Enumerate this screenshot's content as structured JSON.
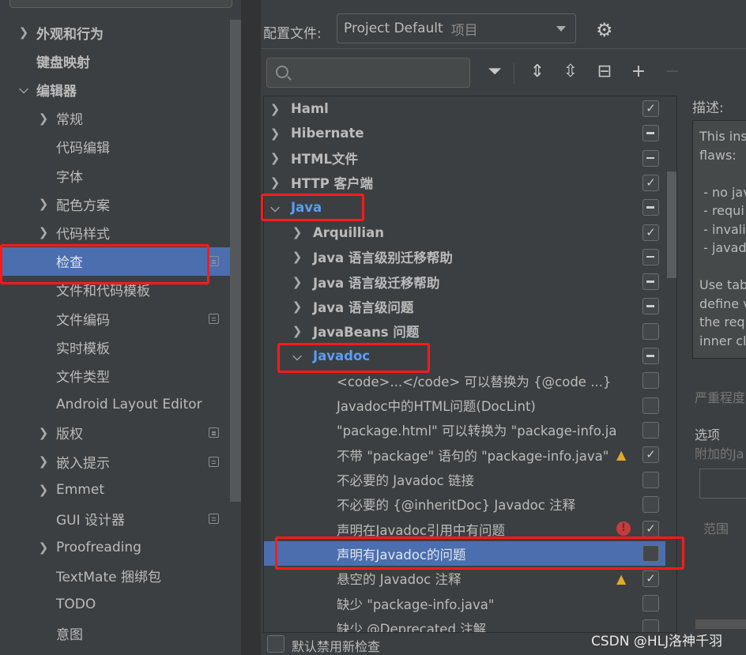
{
  "sidebar": {
    "items": [
      {
        "label": "外观和行为",
        "chevron": "right",
        "bold": true,
        "indent": 0
      },
      {
        "label": "键盘映射",
        "chevron": "",
        "bold": true,
        "indent": 0
      },
      {
        "label": "编辑器",
        "chevron": "down",
        "bold": true,
        "indent": 0
      },
      {
        "label": "常规",
        "chevron": "right",
        "indent": 1
      },
      {
        "label": "代码编辑",
        "chevron": "",
        "indent": 1
      },
      {
        "label": "字体",
        "chevron": "",
        "indent": 1
      },
      {
        "label": "配色方案",
        "chevron": "right",
        "indent": 1
      },
      {
        "label": "代码样式",
        "chevron": "right",
        "indent": 1
      },
      {
        "label": "检查",
        "chevron": "",
        "indent": 1,
        "selected": true,
        "copy": true
      },
      {
        "label": "文件和代码模板",
        "chevron": "",
        "indent": 1
      },
      {
        "label": "文件编码",
        "chevron": "",
        "indent": 1,
        "copy": true
      },
      {
        "label": "实时模板",
        "chevron": "",
        "indent": 1
      },
      {
        "label": "文件类型",
        "chevron": "",
        "indent": 1
      },
      {
        "label": "Android Layout Editor",
        "chevron": "",
        "indent": 1
      },
      {
        "label": "版权",
        "chevron": "right",
        "indent": 1,
        "copy": true
      },
      {
        "label": "嵌入提示",
        "chevron": "right",
        "indent": 1,
        "copy": true
      },
      {
        "label": "Emmet",
        "chevron": "right",
        "indent": 1
      },
      {
        "label": "GUI 设计器",
        "chevron": "",
        "indent": 1,
        "copy": true
      },
      {
        "label": "Proofreading",
        "chevron": "right",
        "indent": 1
      },
      {
        "label": "TextMate 捆绑包",
        "chevron": "",
        "indent": 1
      },
      {
        "label": "TODO",
        "chevron": "",
        "indent": 1
      },
      {
        "label": "意图",
        "chevron": "",
        "indent": 1
      }
    ]
  },
  "profile": {
    "label": "配置文件:",
    "value": "Project Default",
    "scope": "项目"
  },
  "toolbar": {
    "icons": [
      "filter-icon",
      "expand-all-icon",
      "collapse-all-icon",
      "reset-icon",
      "add-icon",
      "remove-icon"
    ]
  },
  "search": {
    "value": "",
    "placeholder": ""
  },
  "tree": {
    "rows": [
      {
        "label": "Haml",
        "level": 0,
        "chevron": "right",
        "state": "checked",
        "bold": true
      },
      {
        "label": "Hibernate",
        "level": 0,
        "chevron": "right",
        "state": "mixed",
        "bold": true
      },
      {
        "label": "HTML文件",
        "level": 0,
        "chevron": "right",
        "state": "mixed",
        "bold": true
      },
      {
        "label": "HTTP 客户端",
        "level": 0,
        "chevron": "right",
        "state": "checked",
        "bold": true
      },
      {
        "label": "Java",
        "level": 0,
        "chevron": "down",
        "state": "mixed",
        "bold": true,
        "highlight": true
      },
      {
        "label": "Arquillian",
        "level": 1,
        "chevron": "right",
        "state": "checked",
        "bold": true
      },
      {
        "label": "Java 语言级别迁移帮助",
        "level": 1,
        "chevron": "right",
        "state": "mixed",
        "bold": true
      },
      {
        "label": "Java 语言级迁移帮助",
        "level": 1,
        "chevron": "right",
        "state": "mixed",
        "bold": true
      },
      {
        "label": "Java 语言级问题",
        "level": 1,
        "chevron": "right",
        "state": "mixed",
        "bold": true
      },
      {
        "label": "JavaBeans 问题",
        "level": 1,
        "chevron": "right",
        "state": "unchecked",
        "bold": true
      },
      {
        "label": "Javadoc",
        "level": 1,
        "chevron": "down",
        "state": "mixed",
        "bold": true,
        "highlight": true
      },
      {
        "label": "<code>...</code> 可以替换为 {@code ...}",
        "level": 2,
        "state": "unchecked"
      },
      {
        "label": "Javadoc中的HTML问题(DocLint)",
        "level": 2,
        "state": "unchecked"
      },
      {
        "label": "\"package.html\" 可以转换为 \"package-info.ja",
        "level": 2,
        "state": "unchecked"
      },
      {
        "label": "不带 \"package\" 语句的 \"package-info.java\"",
        "level": 2,
        "state": "checked",
        "severity": "warning"
      },
      {
        "label": "不必要的 Javadoc 链接",
        "level": 2,
        "state": "unchecked"
      },
      {
        "label": "不必要的 {@inheritDoc} Javadoc 注释",
        "level": 2,
        "state": "unchecked"
      },
      {
        "label": "声明在Javadoc引用中有问题",
        "level": 2,
        "state": "checked",
        "severity": "error"
      },
      {
        "label": "声明有Javadoc的问题",
        "level": 2,
        "state": "unchecked",
        "selected": true
      },
      {
        "label": "悬空的 Javadoc 注释",
        "level": 2,
        "state": "checked",
        "severity": "warning"
      },
      {
        "label": "缺少 \"package-info.java\"",
        "level": 2,
        "state": "unchecked"
      },
      {
        "label": "缺少 @Deprecated 注解",
        "level": 2,
        "state": "unchecked"
      }
    ]
  },
  "description": {
    "label": "描述:",
    "text": "This ins\nflaws:\n\n - no jav\n - requi\n - invali\n - javad\n\nUse tab\ndefine v\nthe req\ninner cl"
  },
  "severity_label": "严重程度",
  "options_label": "选项",
  "options_sub": "附加的Ja",
  "scope_label": "范围",
  "bottom": {
    "disable_new_label": "默认禁用新检查"
  },
  "watermark": "CSDN @HLJ洛神千羽",
  "colors": {
    "selection": "#4b6eaf",
    "highlight_text": "#589df6",
    "annotation_box": "#ff1a1a",
    "warning": "#e2a82a",
    "error": "#c93b3b"
  }
}
